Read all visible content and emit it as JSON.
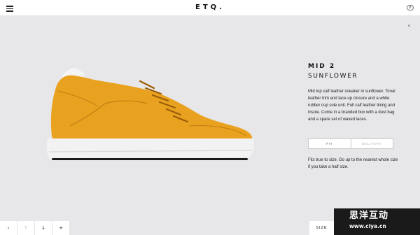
{
  "header": {
    "brand": "ETQ.",
    "cart_count": "0",
    "menu_icon": "hamburger-menu-icon"
  },
  "product": {
    "model": "MID 2",
    "color_name": "SUNFLOWER",
    "description": "Mid top calf leather sneaker in sunflower. Tonal leather trim and lace-up closure and a white rubber cup sole unit. Full calf leather lining and insole. Come in a branded box with a dust bag and a spare set of waxed laces.",
    "shoe_color": "#e9a21f",
    "sole_color": "#f2f2f2"
  },
  "collapse": {
    "glyph": "‹"
  },
  "tabs": [
    {
      "label": "FIT"
    },
    {
      "label": "DELIVERY"
    }
  ],
  "fit_text": "Fits true to size. Go up to the nearest whole size if you take a half size.",
  "toolbar": {
    "items": [
      {
        "glyph": "‹"
      },
      {
        "glyph": "↑"
      },
      {
        "glyph": "↓"
      },
      {
        "glyph": "+"
      }
    ]
  },
  "size_button": "SIZE",
  "watermark": {
    "title": "思洋互动",
    "url": "www.ciya.cn"
  }
}
